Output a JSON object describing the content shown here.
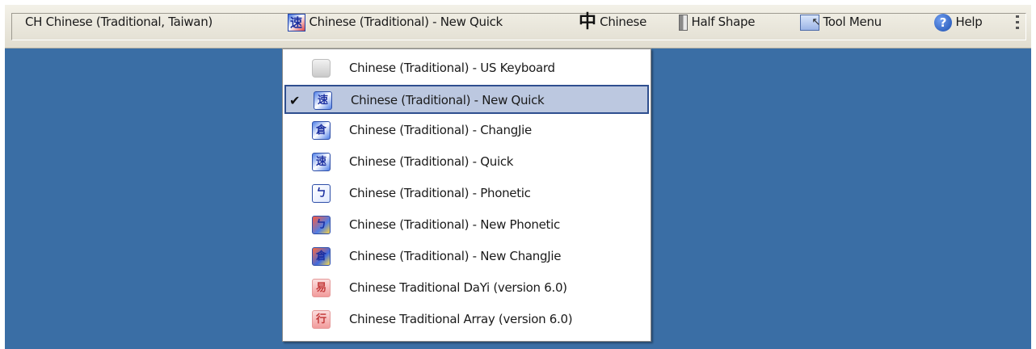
{
  "language_bar": {
    "language_label": "CH Chinese (Traditional, Taiwan)",
    "ime_label": "Chinese (Traditional) - New Quick",
    "mode_label": "Chinese",
    "shape_label": "Half Shape",
    "tool_menu_label": "Tool Menu",
    "help_label": "Help",
    "icons": {
      "ime": "new-quick-ime-icon",
      "mode": "chinese-mode-icon",
      "shape": "half-shape-icon",
      "tool_menu": "tool-menu-icon",
      "help": "help-icon",
      "options": "options-grip-icon"
    }
  },
  "ime_menu": {
    "items": [
      {
        "label": "Chinese (Traditional) - US Keyboard",
        "icon": "keyboard-icon",
        "checked": false
      },
      {
        "label": "Chinese (Traditional) - New Quick",
        "icon": "new-quick-icon",
        "checked": true
      },
      {
        "label": "Chinese (Traditional) - ChangJie",
        "icon": "changjie-icon",
        "checked": false
      },
      {
        "label": "Chinese (Traditional) - Quick",
        "icon": "quick-icon",
        "checked": false
      },
      {
        "label": "Chinese (Traditional) - Phonetic",
        "icon": "phonetic-icon",
        "checked": false
      },
      {
        "label": "Chinese (Traditional) - New Phonetic",
        "icon": "new-phonetic-icon",
        "checked": false
      },
      {
        "label": "Chinese (Traditional) - New ChangJie",
        "icon": "new-changjie-icon",
        "checked": false
      },
      {
        "label": "Chinese Traditional DaYi (version 6.0)",
        "icon": "dayi-icon",
        "checked": false
      },
      {
        "label": "Chinese Traditional Array (version 6.0)",
        "icon": "array-icon",
        "checked": false
      }
    ],
    "check_glyph": "✔"
  },
  "colors": {
    "desktop": "#3a6ea5",
    "selection_fill": "#bcc8e0",
    "selection_border": "#2f4f8f"
  }
}
